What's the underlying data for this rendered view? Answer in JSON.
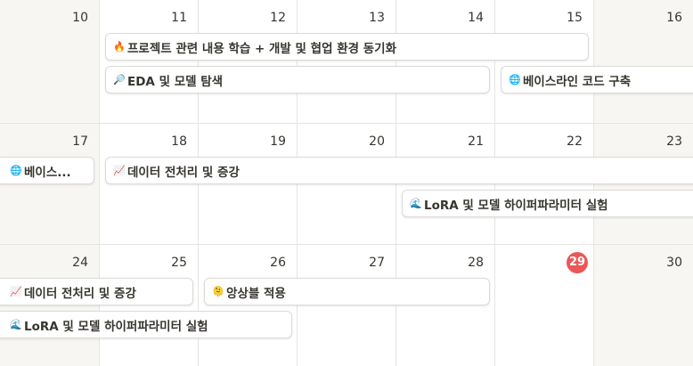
{
  "calendar": {
    "today": "29",
    "weeks": [
      {
        "days": [
          "10",
          "11",
          "12",
          "13",
          "14",
          "15",
          "16"
        ],
        "events": [
          {
            "title": "프로젝트 관련 내용 학습 + 개발 및 협업 환경 동기화",
            "icon": "fire-icon",
            "glyph": "🔥",
            "cls": "icon-fire",
            "start": 1,
            "span": 5,
            "row": 0
          },
          {
            "title": "EDA 및 모델 탐색",
            "icon": "magnifier-icon",
            "glyph": "🔎",
            "cls": "icon-search",
            "start": 1,
            "span": 4,
            "row": 1
          },
          {
            "title": "베이스라인 코드 구축",
            "icon": "globe-icon",
            "glyph": "🌐",
            "cls": "icon-globe",
            "start": 5,
            "span": 2,
            "row": 1,
            "clip_right": true
          }
        ]
      },
      {
        "days": [
          "17",
          "18",
          "19",
          "20",
          "21",
          "22",
          "23"
        ],
        "events": [
          {
            "title": "베이스...",
            "icon": "globe-icon",
            "glyph": "🌐",
            "cls": "icon-globe",
            "start": 0,
            "span": 1,
            "row": 0,
            "clip_left": true
          },
          {
            "title": "데이터 전처리 및 증강",
            "icon": "chart-increasing-icon",
            "glyph": "📈",
            "cls": "icon-chart",
            "start": 1,
            "span": 6,
            "row": 0,
            "clip_right": true
          },
          {
            "title": "LoRA 및 모델 하이퍼파라미터 실험",
            "icon": "wave-icon",
            "glyph": "🌊",
            "cls": "icon-wave",
            "start": 4,
            "span": 3,
            "row": 1,
            "clip_right": true
          }
        ]
      },
      {
        "days": [
          "24",
          "25",
          "26",
          "27",
          "28",
          "29",
          "30"
        ],
        "events": [
          {
            "title": "데이터 전처리 및 증강",
            "icon": "chart-increasing-icon",
            "glyph": "📈",
            "cls": "icon-chart",
            "start": 0,
            "span": 2,
            "row": 0,
            "clip_left": true
          },
          {
            "title": "앙상블 적용",
            "icon": "face-icon",
            "glyph": "🫠",
            "cls": "icon-face",
            "start": 2,
            "span": 3,
            "row": 0
          },
          {
            "title": "LoRA 및 모델 하이퍼파라미터 실험",
            "icon": "wave-icon",
            "glyph": "🌊",
            "cls": "icon-wave",
            "start": 0,
            "span": 3,
            "row": 1,
            "clip_left": true
          }
        ]
      }
    ]
  }
}
